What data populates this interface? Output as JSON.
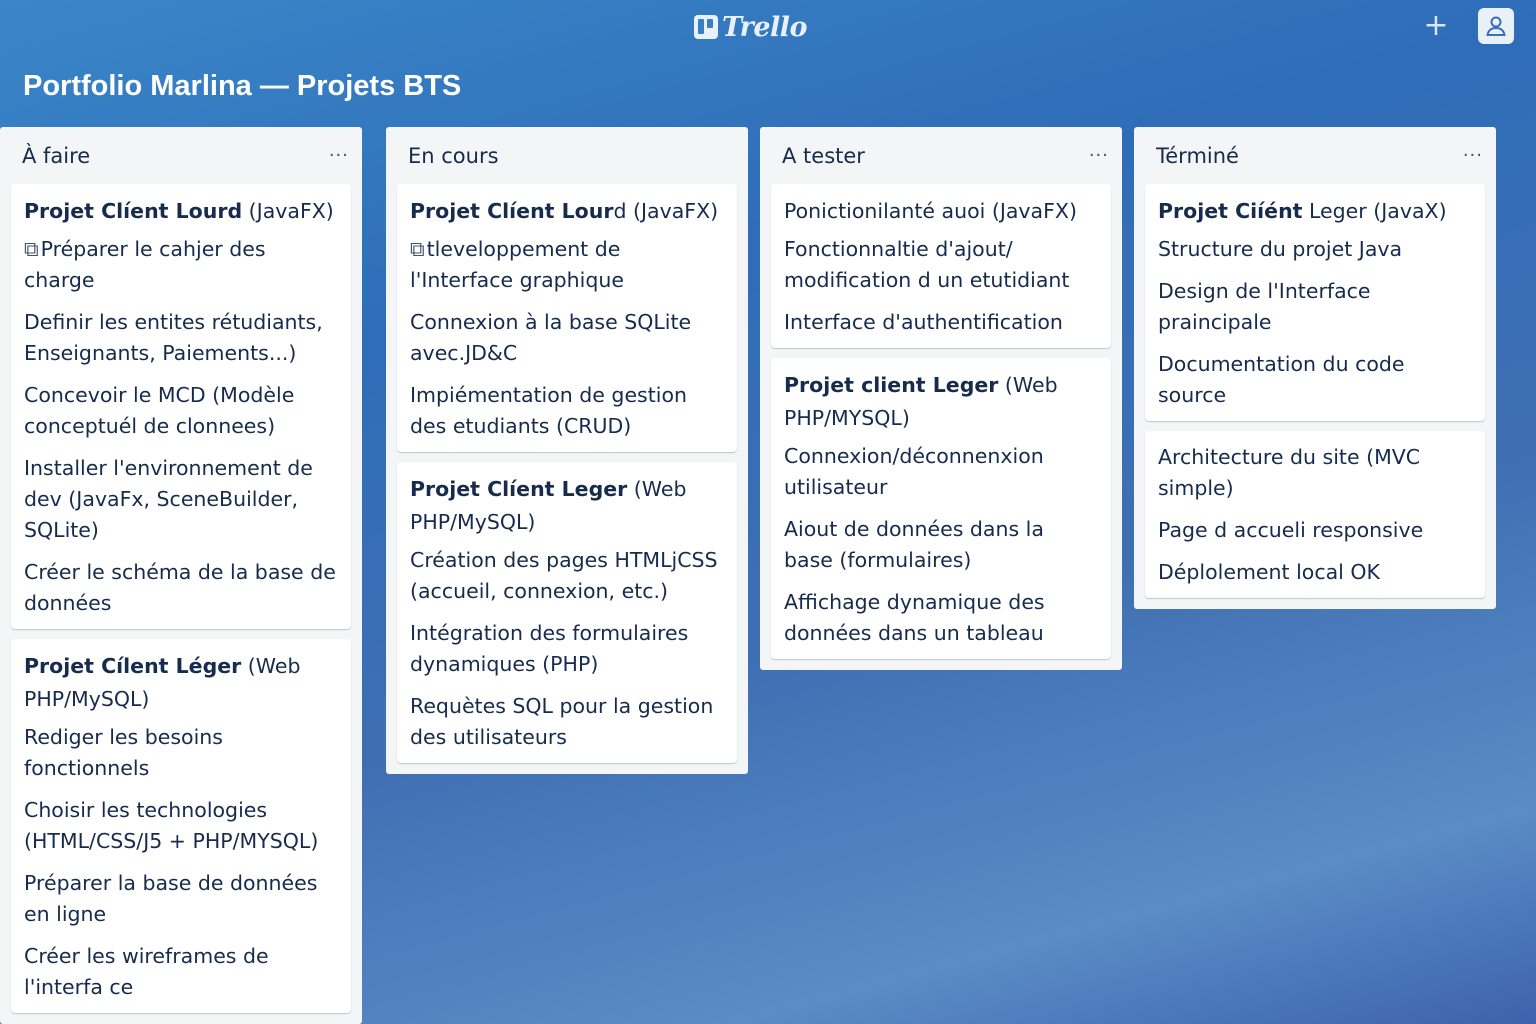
{
  "app": {
    "logo_text": "Trello",
    "add_label": "+",
    "colors": {
      "board_bg": "#2f6db8",
      "list_bg": "#f4f5f7",
      "card_bg": "#ffffff",
      "text": "#172b4d"
    }
  },
  "board": {
    "title": "Portfolio Marlina — Projets BTS"
  },
  "lists": [
    {
      "title": "À faire",
      "menu": "···",
      "cards": [
        {
          "title_bold": "Projet Clíent Lourd",
          "title_rest": " (JavaFX)",
          "items": [
            {
              "icon": "⧉",
              "text": "Préparer le cahjer des charge"
            },
            {
              "text": "Definir les entites rétudiants, Enseignants, Paiements...)"
            },
            {
              "text": "Concevoir le MCD (Modèle conceptuél de clonnees)"
            },
            {
              "text": "Installer l'environnement de dev (JavaFx, SceneBuilder, SQLite)"
            },
            {
              "text": "Créer le schéma de la base de données"
            }
          ]
        },
        {
          "title_bold": "Projet Cílent Léger",
          "title_rest": " (Web PHP/MySQL)",
          "items": [
            {
              "text": "Rediger les besoins fonctionnels"
            },
            {
              "text": "Choisir les technologies (HTML/CSS/J5 + PHP/MYSQL)"
            },
            {
              "text": "Préparer la base de données en ligne"
            },
            {
              "text": "Créer les wireframes de l'interfa ce"
            }
          ]
        }
      ]
    },
    {
      "title": "En cours",
      "menu": "",
      "cards": [
        {
          "title_bold": "Projet Clíent Lour",
          "title_rest": "d (JavaFX)",
          "items": [
            {
              "icon": "⧉",
              "text": "tlevelоppement de l'Interface graphique"
            },
            {
              "text": "Connexion à la base SQLite avec.JD&C"
            },
            {
              "text": "Impiémentation de gestion des etudiants (CRUD)"
            }
          ]
        },
        {
          "title_bold": "Projet Clíent Leger",
          "title_rest": " (Web PHP/MySQL)",
          "items": [
            {
              "text": "Création des pages HTMLjCSS (accueil, connexion, etc.)"
            },
            {
              "text": "Intégration des formulaires dynamiques (PHP)"
            },
            {
              "text": "Requètes SQL pour la gestion des utilisateurs"
            }
          ]
        }
      ]
    },
    {
      "title": "A tester",
      "menu": "···",
      "cards": [
        {
          "title_bold": "",
          "title_rest": "Ponictionilanté auoi (JavaFX)",
          "items": [
            {
              "text": "Fonctionnaltie d'ajout/ modification d un etutidiant"
            },
            {
              "text": "Interface d'authentification"
            }
          ]
        },
        {
          "title_bold": "Projet client Leger",
          "title_rest": " (Web PHP/MYSQL)",
          "items": [
            {
              "text": "Connexion/déconnenxion utilisateur"
            },
            {
              "text": "Aiout de données dans la base (formulaires)"
            },
            {
              "text": "Affichage dynamique des données dans un tableau"
            }
          ]
        }
      ]
    },
    {
      "title": "Términé",
      "menu": "···",
      "cards": [
        {
          "title_bold": "Projet Ciíént",
          "title_rest": " Leger (JavaX)",
          "items": [
            {
              "text": "Structure du projet Java"
            },
            {
              "text": "Design de l'Interface praincipale"
            },
            {
              "text": "Documentation du code source"
            }
          ]
        },
        {
          "title_bold": "",
          "title_rest": "",
          "items": [
            {
              "text": "Architecture du site (MVC simple)"
            },
            {
              "text": "Page d accueli responsive"
            },
            {
              "text": "Déplolement local OK"
            }
          ]
        }
      ]
    }
  ]
}
